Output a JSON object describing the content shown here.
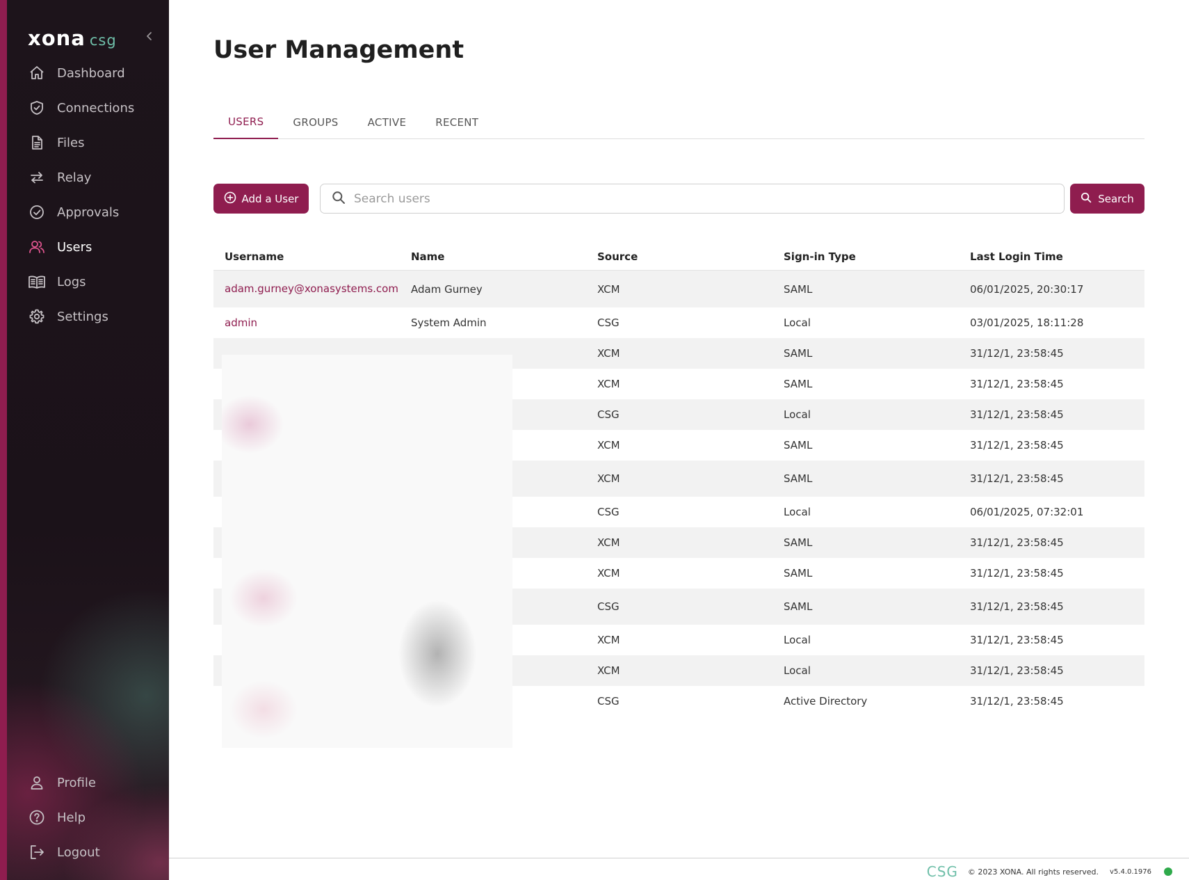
{
  "brand": {
    "name": "xona",
    "product": "csg"
  },
  "sidebar": {
    "items": [
      {
        "label": "Dashboard",
        "icon": "home-icon"
      },
      {
        "label": "Connections",
        "icon": "shield-icon"
      },
      {
        "label": "Files",
        "icon": "file-icon"
      },
      {
        "label": "Relay",
        "icon": "swap-arrows-icon"
      },
      {
        "label": "Approvals",
        "icon": "check-circle-icon"
      },
      {
        "label": "Users",
        "icon": "users-icon",
        "active": true
      },
      {
        "label": "Logs",
        "icon": "book-icon"
      },
      {
        "label": "Settings",
        "icon": "gear-icon"
      }
    ],
    "bottom": [
      {
        "label": "Profile",
        "icon": "person-icon"
      },
      {
        "label": "Help",
        "icon": "help-circle-icon"
      },
      {
        "label": "Logout",
        "icon": "logout-icon"
      }
    ]
  },
  "page": {
    "title": "User Management"
  },
  "tabs": [
    {
      "label": "USERS",
      "active": true
    },
    {
      "label": "GROUPS"
    },
    {
      "label": "ACTIVE"
    },
    {
      "label": "RECENT"
    }
  ],
  "toolbar": {
    "add_label": "Add a User",
    "search_placeholder": "Search users",
    "search_label": "Search"
  },
  "table": {
    "columns": [
      "Username",
      "Name",
      "Source",
      "Sign-in Type",
      "Last Login Time"
    ],
    "rows": [
      {
        "username": "adam.gurney@xonasystems.com",
        "name": "Adam Gurney",
        "source": "XCM",
        "signin": "SAML",
        "last_login": "06/01/2025, 20:30:17"
      },
      {
        "username": "admin",
        "name": "System Admin",
        "source": "CSG",
        "signin": "Local",
        "last_login": "03/01/2025, 18:11:28"
      },
      {
        "username": "",
        "name": "",
        "source": "XCM",
        "signin": "SAML",
        "last_login": "31/12/1, 23:58:45"
      },
      {
        "username": "",
        "name": "",
        "source": "XCM",
        "signin": "SAML",
        "last_login": "31/12/1, 23:58:45"
      },
      {
        "username": "",
        "name": "",
        "source": "CSG",
        "signin": "Local",
        "last_login": "31/12/1, 23:58:45"
      },
      {
        "username": "",
        "name": "",
        "source": "XCM",
        "signin": "SAML",
        "last_login": "31/12/1, 23:58:45"
      },
      {
        "username": "",
        "name": "",
        "source": "XCM",
        "signin": "SAML",
        "last_login": "31/12/1, 23:58:45"
      },
      {
        "username": "",
        "name": "",
        "source": "CSG",
        "signin": "Local",
        "last_login": "06/01/2025, 07:32:01"
      },
      {
        "username": "",
        "name": "",
        "source": "XCM",
        "signin": "SAML",
        "last_login": "31/12/1, 23:58:45"
      },
      {
        "username": "",
        "name": "",
        "source": "XCM",
        "signin": "SAML",
        "last_login": "31/12/1, 23:58:45"
      },
      {
        "username": "",
        "name": "",
        "source": "CSG",
        "signin": "SAML",
        "last_login": "31/12/1, 23:58:45"
      },
      {
        "username": "",
        "name": "",
        "source": "XCM",
        "signin": "Local",
        "last_login": "31/12/1, 23:58:45"
      },
      {
        "username": "",
        "name": "",
        "source": "XCM",
        "signin": "Local",
        "last_login": "31/12/1, 23:58:45"
      },
      {
        "username": "",
        "name": "",
        "source": "CSG",
        "signin": "Active Directory",
        "last_login": "31/12/1, 23:58:45"
      }
    ]
  },
  "footer": {
    "logo": "CSG",
    "copyright": "© 2023 XONA. All rights reserved.",
    "version": "v5.4.0.1976",
    "status_color": "#2faa4b"
  },
  "colors": {
    "accent": "#8f1d4f",
    "brand_teal": "#6fbfa9",
    "sidebar_bg": "#1d141b"
  }
}
